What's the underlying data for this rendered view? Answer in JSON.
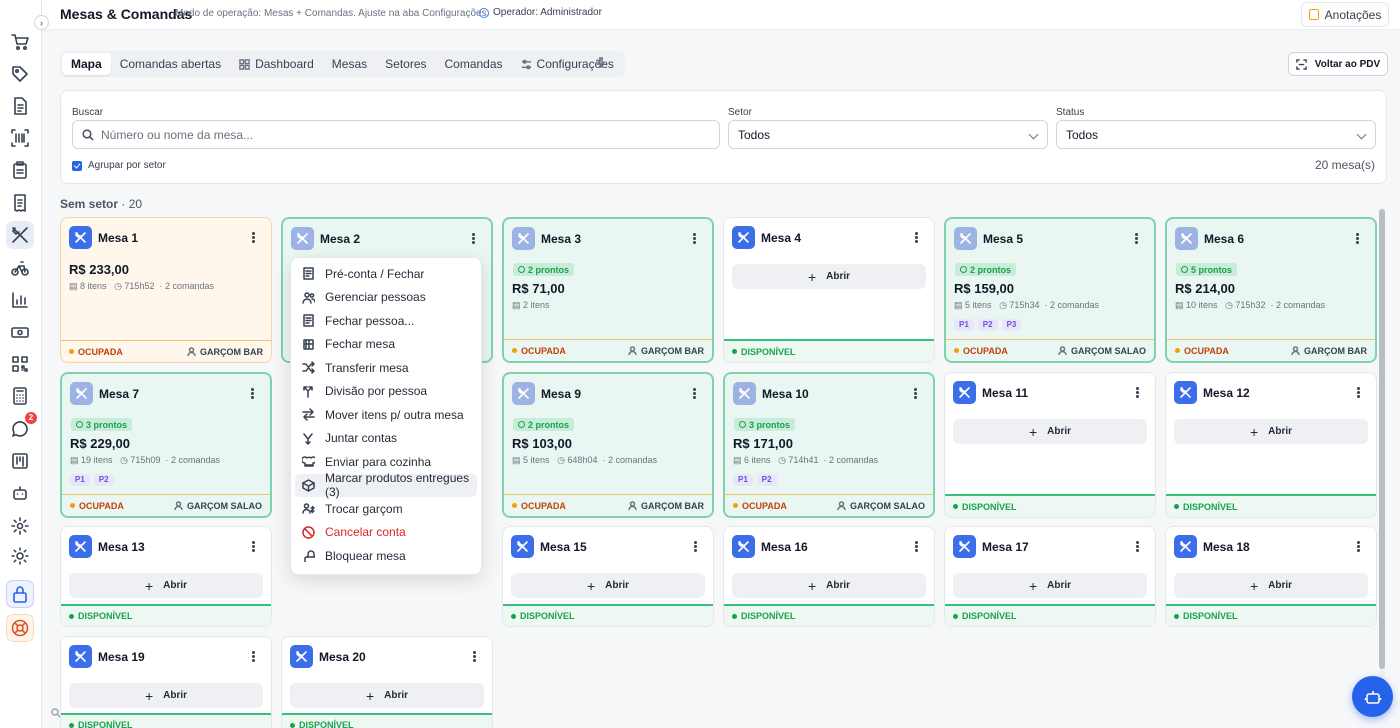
{
  "header": {
    "title": "Mesas & Comandas",
    "subtitle": "Modo de operação: Mesas + Comandas. Ajuste na aba Configurações.",
    "operator": "Operador: Administrador",
    "notes_label": "Anotações"
  },
  "tabs": [
    {
      "label": "Mapa",
      "icon": "none",
      "active": true
    },
    {
      "label": "Comandas abertas",
      "icon": "none"
    },
    {
      "label": "Dashboard",
      "icon": "grid-icon"
    },
    {
      "label": "Mesas",
      "icon": "none"
    },
    {
      "label": "Setores",
      "icon": "none"
    },
    {
      "label": "Comandas",
      "icon": "none"
    },
    {
      "label": "Configurações",
      "icon": "settings-icon"
    }
  ],
  "back_label": "Voltar ao PDV",
  "filters": {
    "search_label": "Buscar",
    "search_placeholder": "Número ou nome da mesa...",
    "sector_label": "Setor",
    "sector_value": "Todos",
    "status_label": "Status",
    "status_value": "Todos",
    "group_label": "Agrupar por setor",
    "group_checked": true,
    "count": "20 mesa(s)"
  },
  "section": {
    "name": "Sem setor",
    "count": "· 20"
  },
  "open_label": "Abrir",
  "status_busy": "OCUPADA",
  "status_free": "DISPONÍVEL",
  "tables": [
    {
      "name": "Mesa 1",
      "state": "busy",
      "total": "R$ 233,00",
      "items": "8 itens",
      "time": "715h52",
      "commands": "· 2 comandas",
      "waiter": "GARÇOM BAR"
    },
    {
      "name": "Mesa 2",
      "state": "ready"
    },
    {
      "name": "Mesa 3",
      "state": "ready",
      "ready_pill": "2 prontos",
      "total": "R$ 71,00",
      "items": "2 itens",
      "waiter": "GARÇOM BAR"
    },
    {
      "name": "Mesa 4",
      "state": "free"
    },
    {
      "name": "Mesa 5",
      "state": "ready",
      "ready_pill": "2 prontos",
      "total": "R$ 159,00",
      "items": "5 itens",
      "time": "715h34",
      "commands": "· 2 comandas",
      "people": [
        "P1",
        "P2",
        "P3"
      ],
      "waiter": "GARÇOM SALAO"
    },
    {
      "name": "Mesa 6",
      "state": "ready",
      "ready_pill": "5 prontos",
      "total": "R$ 214,00",
      "items": "10 itens",
      "time": "715h32",
      "commands": "· 2 comandas",
      "waiter": "GARÇOM BAR"
    },
    {
      "name": "Mesa 7",
      "state": "ready",
      "ready_pill": "3 prontos",
      "total": "R$ 229,00",
      "items": "19 itens",
      "time": "715h09",
      "commands": "· 2 comandas",
      "people": [
        "P1",
        "P2"
      ],
      "waiter": "GARÇOM SALAO"
    },
    {
      "name": "Mesa 9",
      "state": "ready",
      "ready_pill": "2 prontos",
      "total": "R$ 103,00",
      "items": "5 itens",
      "time": "648h04",
      "commands": "· 2 comandas",
      "waiter": "GARÇOM BAR"
    },
    {
      "name": "Mesa 10",
      "state": "ready",
      "ready_pill": "3 prontos",
      "total": "R$ 171,00",
      "items": "6 itens",
      "time": "714h41",
      "commands": "· 2 comandas",
      "people": [
        "P1",
        "P2"
      ],
      "waiter": "GARÇOM SALAO"
    },
    {
      "name": "Mesa 11",
      "state": "free"
    },
    {
      "name": "Mesa 12",
      "state": "free"
    },
    {
      "name": "Mesa 13",
      "state": "free"
    },
    {
      "name": "Mesa 15",
      "state": "free"
    },
    {
      "name": "Mesa 16",
      "state": "free"
    },
    {
      "name": "Mesa 17",
      "state": "free"
    },
    {
      "name": "Mesa 18",
      "state": "free"
    },
    {
      "name": "Mesa 19",
      "state": "free"
    },
    {
      "name": "Mesa 20",
      "state": "free"
    }
  ],
  "menu": [
    {
      "label": "Pré-conta / Fechar",
      "icon": "receipt-icon"
    },
    {
      "label": "Gerenciar pessoas",
      "icon": "people-icon"
    },
    {
      "label": "Fechar pessoa...",
      "icon": "receipt-icon"
    },
    {
      "label": "Fechar mesa",
      "icon": "table-icon"
    },
    {
      "label": "Transferir mesa",
      "icon": "shuffle-icon"
    },
    {
      "label": "Divisão por pessoa",
      "icon": "split-icon"
    },
    {
      "label": "Mover itens p/ outra mesa",
      "icon": "arrows-icon"
    },
    {
      "label": "Juntar contas",
      "icon": "merge-icon"
    },
    {
      "label": "Enviar para cozinha",
      "icon": "chef-hat-icon"
    },
    {
      "label": "Marcar produtos entregues (3)",
      "icon": "package-icon",
      "highlighted": true
    },
    {
      "label": "Trocar garçom",
      "icon": "user-switch-icon"
    },
    {
      "label": "Cancelar conta",
      "icon": "ban-icon",
      "danger": true
    },
    {
      "label": "Bloquear mesa",
      "icon": "lock-icon"
    }
  ],
  "rail": [
    "cart-icon",
    "tag-icon",
    "document-icon",
    "barcode-icon",
    "clipboard-icon",
    "invoice-icon",
    "utensils-icon",
    "bike-icon",
    "chart-icon",
    "cash-icon",
    "qr-icon",
    "calculator-icon",
    "chat-icon",
    "kanban-icon",
    "robot-icon",
    "settings-icon",
    "sun-icon",
    "lock-icon",
    "help-icon"
  ],
  "chat_badge": "2",
  "colors": {
    "accent": "#2563eb",
    "ready": "#34c17e",
    "busy": "#f59e0b",
    "danger": "#dc2626"
  }
}
